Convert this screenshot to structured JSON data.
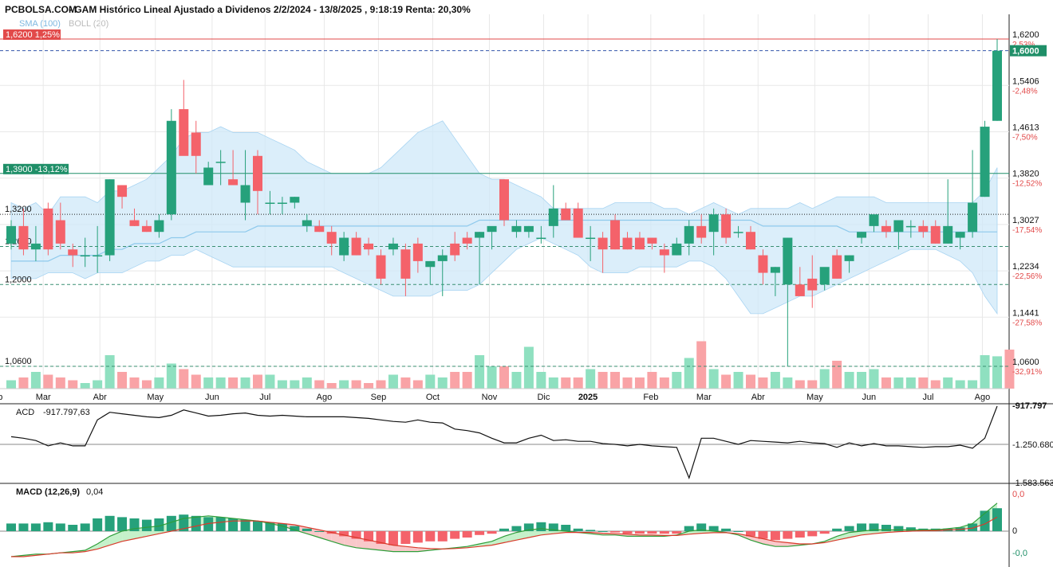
{
  "header": {
    "site": "PCBOLSA.COM",
    "title": "- GAM Histórico Lineal Ajustado a Dividenos 2/2/2024 - 13/8/2025 , 9:18:19 Renta: 20,30%"
  },
  "legend": {
    "sma": "SMA (100)",
    "boll": "BOLL (20)"
  },
  "colors": {
    "up": "#26a17b",
    "down": "#f4626a",
    "band": "#cfe8f8",
    "sma": "#8ec9ec",
    "grid": "#e8e8e8",
    "vol_up": "#8fe0c0",
    "vol_down": "#f9a3a6",
    "alert": "#e24a4a",
    "price_tag": "#1f8f68"
  },
  "price_levels": [
    {
      "label": "1,6200",
      "pct": "2,53%",
      "value": 1.62
    },
    {
      "label": "1,5406",
      "pct": "-2,48%",
      "value": 1.5406
    },
    {
      "label": "1,4613",
      "pct": "-7,50%",
      "value": 1.4613
    },
    {
      "label": "1,3820",
      "pct": "-12,52%",
      "value": 1.382
    },
    {
      "label": "1,3027",
      "pct": "-17,54%",
      "value": 1.3027
    },
    {
      "label": "1,2234",
      "pct": "-22,56%",
      "value": 1.2234
    },
    {
      "label": "1,1441",
      "pct": "-27,58%",
      "value": 1.1441
    },
    {
      "label": "1,0600",
      "pct": "-32,91%",
      "value": 1.06
    }
  ],
  "last_price": {
    "label": "1,6000",
    "value": 1.6
  },
  "alerts": [
    {
      "label": "1,6200",
      "pct": "1,25%",
      "value": 1.62,
      "style": "red"
    },
    {
      "label": "1,3900",
      "pct": "-13,12%",
      "value": 1.39,
      "style": "green"
    }
  ],
  "reference_lines": [
    {
      "label": "1,3200",
      "value": 1.32,
      "style": "black-dots"
    },
    {
      "label": "1,2650",
      "value": 1.265,
      "style": "dash"
    },
    {
      "label": "1,2000",
      "value": 1.2,
      "style": "dash"
    },
    {
      "label": "1,0600",
      "value": 1.06,
      "style": "dash"
    }
  ],
  "months": [
    {
      "label": "Feb",
      "i": -1.3
    },
    {
      "label": "Mar",
      "i": 2.6
    },
    {
      "label": "Abr",
      "i": 7.2
    },
    {
      "label": "May",
      "i": 11.7
    },
    {
      "label": "Jun",
      "i": 16.3
    },
    {
      "label": "Jul",
      "i": 20.6
    },
    {
      "label": "Ago",
      "i": 25.4
    },
    {
      "label": "Sep",
      "i": 29.8
    },
    {
      "label": "Oct",
      "i": 34.2
    },
    {
      "label": "Nov",
      "i": 38.8
    },
    {
      "label": "Dic",
      "i": 43.2
    },
    {
      "label": "2025",
      "i": 46.8,
      "bold": true
    },
    {
      "label": "Feb",
      "i": 51.9
    },
    {
      "label": "Mar",
      "i": 56.2
    },
    {
      "label": "Abr",
      "i": 60.6
    },
    {
      "label": "May",
      "i": 65.2
    },
    {
      "label": "Jun",
      "i": 69.6
    },
    {
      "label": "Jul",
      "i": 74.4
    },
    {
      "label": "Ago",
      "i": 78.8
    }
  ],
  "chart_data": {
    "type": "candlestick",
    "yrange": [
      1.06,
      1.62
    ],
    "candles": [
      [
        1.27,
        1.31,
        1.26,
        1.3
      ],
      [
        1.3,
        1.33,
        1.25,
        1.26
      ],
      [
        1.26,
        1.3,
        1.24,
        1.27
      ],
      [
        1.33,
        1.34,
        1.25,
        1.26
      ],
      [
        1.31,
        1.34,
        1.26,
        1.27
      ],
      [
        1.26,
        1.27,
        1.23,
        1.25
      ],
      [
        1.25,
        1.28,
        1.23,
        1.25
      ],
      [
        1.25,
        1.3,
        1.22,
        1.25
      ],
      [
        1.25,
        1.38,
        1.24,
        1.38
      ],
      [
        1.37,
        1.37,
        1.33,
        1.35
      ],
      [
        1.31,
        1.33,
        1.3,
        1.3
      ],
      [
        1.3,
        1.31,
        1.29,
        1.29
      ],
      [
        1.29,
        1.32,
        1.28,
        1.31
      ],
      [
        1.32,
        1.5,
        1.31,
        1.48
      ],
      [
        1.5,
        1.55,
        1.44,
        1.42
      ],
      [
        1.46,
        1.48,
        1.39,
        1.42
      ],
      [
        1.37,
        1.41,
        1.37,
        1.4
      ],
      [
        1.41,
        1.43,
        1.37,
        1.41
      ],
      [
        1.38,
        1.43,
        1.37,
        1.37
      ],
      [
        1.34,
        1.43,
        1.31,
        1.37
      ],
      [
        1.42,
        1.43,
        1.32,
        1.36
      ],
      [
        1.34,
        1.36,
        1.32,
        1.34
      ],
      [
        1.34,
        1.35,
        1.32,
        1.34
      ],
      [
        1.34,
        1.35,
        1.33,
        1.35
      ],
      [
        1.3,
        1.32,
        1.29,
        1.31
      ],
      [
        1.3,
        1.31,
        1.29,
        1.29
      ],
      [
        1.29,
        1.3,
        1.25,
        1.27
      ],
      [
        1.25,
        1.29,
        1.24,
        1.28
      ],
      [
        1.28,
        1.29,
        1.25,
        1.25
      ],
      [
        1.27,
        1.28,
        1.25,
        1.26
      ],
      [
        1.25,
        1.26,
        1.2,
        1.21
      ],
      [
        1.26,
        1.28,
        1.25,
        1.27
      ],
      [
        1.26,
        1.27,
        1.18,
        1.21
      ],
      [
        1.27,
        1.28,
        1.22,
        1.24
      ],
      [
        1.23,
        1.24,
        1.2,
        1.24
      ],
      [
        1.24,
        1.26,
        1.18,
        1.25
      ],
      [
        1.27,
        1.29,
        1.24,
        1.25
      ],
      [
        1.28,
        1.29,
        1.26,
        1.27
      ],
      [
        1.28,
        1.29,
        1.2,
        1.29
      ],
      [
        1.29,
        1.29,
        1.26,
        1.3
      ],
      [
        1.38,
        1.38,
        1.3,
        1.31
      ],
      [
        1.29,
        1.31,
        1.28,
        1.3
      ],
      [
        1.29,
        1.3,
        1.28,
        1.3
      ],
      [
        1.28,
        1.3,
        1.27,
        1.28
      ],
      [
        1.3,
        1.37,
        1.28,
        1.33
      ],
      [
        1.33,
        1.34,
        1.31,
        1.31
      ],
      [
        1.33,
        1.34,
        1.28,
        1.28
      ],
      [
        1.28,
        1.3,
        1.24,
        1.28
      ],
      [
        1.28,
        1.29,
        1.22,
        1.26
      ],
      [
        1.31,
        1.32,
        1.26,
        1.26
      ],
      [
        1.28,
        1.29,
        1.26,
        1.26
      ],
      [
        1.28,
        1.29,
        1.26,
        1.26
      ],
      [
        1.28,
        1.28,
        1.26,
        1.27
      ],
      [
        1.26,
        1.27,
        1.22,
        1.25
      ],
      [
        1.25,
        1.28,
        1.25,
        1.27
      ],
      [
        1.27,
        1.31,
        1.25,
        1.3
      ],
      [
        1.3,
        1.32,
        1.27,
        1.28
      ],
      [
        1.29,
        1.33,
        1.25,
        1.32
      ],
      [
        1.32,
        1.33,
        1.27,
        1.28
      ],
      [
        1.29,
        1.3,
        1.28,
        1.29
      ],
      [
        1.29,
        1.3,
        1.26,
        1.26
      ],
      [
        1.25,
        1.26,
        1.2,
        1.22
      ],
      [
        1.22,
        1.23,
        1.18,
        1.23
      ],
      [
        1.2,
        1.28,
        1.06,
        1.28
      ],
      [
        1.2,
        1.23,
        1.18,
        1.18
      ],
      [
        1.21,
        1.25,
        1.16,
        1.19
      ],
      [
        1.2,
        1.22,
        1.19,
        1.23
      ],
      [
        1.25,
        1.26,
        1.21,
        1.21
      ],
      [
        1.24,
        1.25,
        1.22,
        1.25
      ],
      [
        1.28,
        1.29,
        1.27,
        1.29
      ],
      [
        1.3,
        1.32,
        1.29,
        1.32
      ],
      [
        1.3,
        1.31,
        1.28,
        1.29
      ],
      [
        1.29,
        1.31,
        1.26,
        1.31
      ],
      [
        1.3,
        1.31,
        1.28,
        1.3
      ],
      [
        1.3,
        1.31,
        1.28,
        1.29
      ],
      [
        1.3,
        1.31,
        1.27,
        1.27
      ],
      [
        1.27,
        1.38,
        1.27,
        1.3
      ],
      [
        1.28,
        1.29,
        1.26,
        1.29
      ],
      [
        1.29,
        1.43,
        1.28,
        1.34
      ],
      [
        1.35,
        1.48,
        1.35,
        1.47
      ],
      [
        1.48,
        1.62,
        1.48,
        1.6
      ]
    ],
    "bollinger": {
      "upper": [
        1.34,
        1.33,
        1.34,
        1.32,
        1.35,
        1.35,
        1.35,
        1.34,
        1.36,
        1.36,
        1.37,
        1.38,
        1.4,
        1.42,
        1.45,
        1.46,
        1.46,
        1.47,
        1.46,
        1.46,
        1.46,
        1.45,
        1.44,
        1.43,
        1.41,
        1.4,
        1.39,
        1.39,
        1.39,
        1.39,
        1.4,
        1.42,
        1.44,
        1.46,
        1.47,
        1.48,
        1.45,
        1.42,
        1.39,
        1.38,
        1.38,
        1.37,
        1.36,
        1.35,
        1.33,
        1.33,
        1.33,
        1.33,
        1.33,
        1.34,
        1.34,
        1.34,
        1.34,
        1.33,
        1.33,
        1.32,
        1.33,
        1.34,
        1.33,
        1.32,
        1.33,
        1.33,
        1.33,
        1.33,
        1.34,
        1.33,
        1.34,
        1.35,
        1.35,
        1.35,
        1.35,
        1.34,
        1.34,
        1.34,
        1.34,
        1.34,
        1.34,
        1.34,
        1.34,
        1.36,
        1.4
      ],
      "lower": [
        1.21,
        1.21,
        1.21,
        1.22,
        1.22,
        1.22,
        1.21,
        1.22,
        1.22,
        1.22,
        1.23,
        1.24,
        1.24,
        1.25,
        1.25,
        1.26,
        1.25,
        1.24,
        1.23,
        1.23,
        1.23,
        1.23,
        1.23,
        1.23,
        1.23,
        1.23,
        1.23,
        1.22,
        1.21,
        1.2,
        1.19,
        1.18,
        1.18,
        1.18,
        1.18,
        1.19,
        1.19,
        1.19,
        1.2,
        1.22,
        1.24,
        1.26,
        1.27,
        1.28,
        1.27,
        1.26,
        1.25,
        1.23,
        1.22,
        1.22,
        1.22,
        1.23,
        1.23,
        1.23,
        1.23,
        1.24,
        1.24,
        1.23,
        1.21,
        1.18,
        1.15,
        1.15,
        1.16,
        1.17,
        1.18,
        1.18,
        1.19,
        1.2,
        1.21,
        1.22,
        1.23,
        1.24,
        1.25,
        1.26,
        1.26,
        1.26,
        1.25,
        1.24,
        1.22,
        1.18,
        1.15
      ]
    },
    "sma": [
      1.24,
      1.24,
      1.24,
      1.24,
      1.25,
      1.25,
      1.25,
      1.25,
      1.26,
      1.26,
      1.27,
      1.27,
      1.27,
      1.28,
      1.28,
      1.29,
      1.29,
      1.29,
      1.29,
      1.29,
      1.3,
      1.3,
      1.3,
      1.3,
      1.3,
      1.3,
      1.3,
      1.3,
      1.3,
      1.3,
      1.3,
      1.3,
      1.3,
      1.3,
      1.3,
      1.3,
      1.3,
      1.3,
      1.31,
      1.31,
      1.31,
      1.31,
      1.31,
      1.31,
      1.31,
      1.31,
      1.31,
      1.31,
      1.31,
      1.31,
      1.31,
      1.31,
      1.31,
      1.31,
      1.31,
      1.31,
      1.31,
      1.31,
      1.31,
      1.31,
      1.31,
      1.3,
      1.3,
      1.3,
      1.3,
      1.3,
      1.3,
      1.3,
      1.29,
      1.29,
      1.29,
      1.29,
      1.29,
      1.29,
      1.29,
      1.29,
      1.29,
      1.29,
      1.29,
      1.29,
      1.29
    ],
    "volume": [
      0.15,
      0.2,
      0.3,
      0.25,
      0.2,
      0.15,
      0.1,
      0.15,
      0.6,
      0.3,
      0.2,
      0.15,
      0.2,
      0.45,
      0.35,
      0.25,
      0.2,
      0.2,
      0.2,
      0.2,
      0.25,
      0.25,
      0.15,
      0.15,
      0.2,
      0.15,
      0.1,
      0.15,
      0.15,
      0.1,
      0.15,
      0.25,
      0.2,
      0.15,
      0.25,
      0.2,
      0.3,
      0.3,
      0.6,
      0.4,
      0.4,
      0.3,
      0.75,
      0.3,
      0.2,
      0.2,
      0.2,
      0.35,
      0.3,
      0.3,
      0.2,
      0.2,
      0.3,
      0.2,
      0.3,
      0.55,
      0.85,
      0.35,
      0.25,
      0.3,
      0.25,
      0.2,
      0.3,
      0.2,
      0.15,
      0.15,
      0.35,
      0.5,
      0.3,
      0.3,
      0.35,
      0.2,
      0.2,
      0.2,
      0.2,
      0.15,
      0.2,
      0.15,
      0.15,
      0.6,
      0.58,
      0.7
    ]
  },
  "acd": {
    "label": "ACD",
    "value": "-917.797,63",
    "right_label": "-1.250.680",
    "top_label": "-917.797",
    "bottom_label": "-1.583.563",
    "series": [
      0.6,
      0.58,
      0.55,
      0.48,
      0.52,
      0.48,
      0.48,
      0.82,
      0.92,
      0.9,
      0.88,
      0.86,
      0.85,
      0.88,
      0.95,
      0.91,
      0.87,
      0.88,
      0.9,
      0.91,
      0.88,
      0.87,
      0.88,
      0.87,
      0.86,
      0.86,
      0.86,
      0.86,
      0.85,
      0.84,
      0.82,
      0.8,
      0.79,
      0.82,
      0.79,
      0.78,
      0.7,
      0.68,
      0.65,
      0.58,
      0.52,
      0.52,
      0.58,
      0.62,
      0.55,
      0.56,
      0.54,
      0.54,
      0.51,
      0.5,
      0.48,
      0.5,
      0.48,
      0.47,
      0.46,
      0.06,
      0.58,
      0.58,
      0.54,
      0.5,
      0.55,
      0.54,
      0.53,
      0.52,
      0.54,
      0.52,
      0.51,
      0.46,
      0.52,
      0.48,
      0.51,
      0.48,
      0.48,
      0.47,
      0.46,
      0.47,
      0.47,
      0.49,
      0.45,
      0.58,
      1.0
    ]
  },
  "macd": {
    "label": "MACD (12,26,9)",
    "value": "0,04",
    "top_label": "0,0",
    "mid_label": "0",
    "bottom_label": "-0,0",
    "hist": [
      0.3,
      0.3,
      0.3,
      0.35,
      0.3,
      0.25,
      0.3,
      0.5,
      0.6,
      0.55,
      0.5,
      0.45,
      0.5,
      0.6,
      0.65,
      0.6,
      0.55,
      0.55,
      0.5,
      0.45,
      0.4,
      0.35,
      0.3,
      0.2,
      0.1,
      0.0,
      -0.1,
      -0.2,
      -0.3,
      -0.4,
      -0.5,
      -0.55,
      -0.5,
      -0.45,
      -0.4,
      -0.4,
      -0.3,
      -0.25,
      -0.15,
      -0.1,
      0.1,
      0.2,
      0.3,
      0.35,
      0.3,
      0.25,
      0.1,
      0.05,
      0.0,
      -0.05,
      -0.1,
      -0.1,
      -0.1,
      -0.1,
      -0.1,
      0.2,
      0.3,
      0.2,
      0.1,
      0.0,
      -0.2,
      -0.3,
      -0.35,
      -0.3,
      -0.25,
      -0.2,
      -0.1,
      0.1,
      0.2,
      0.3,
      0.3,
      0.25,
      0.2,
      0.15,
      0.1,
      0.1,
      0.1,
      0.15,
      0.3,
      0.8,
      0.9
    ],
    "line": [
      -1.0,
      -0.95,
      -0.9,
      -0.9,
      -0.85,
      -0.8,
      -0.75,
      -0.5,
      -0.2,
      0.0,
      0.1,
      0.15,
      0.2,
      0.35,
      0.5,
      0.55,
      0.6,
      0.55,
      0.5,
      0.45,
      0.4,
      0.3,
      0.2,
      0.05,
      -0.1,
      -0.25,
      -0.4,
      -0.55,
      -0.65,
      -0.7,
      -0.75,
      -0.8,
      -0.8,
      -0.8,
      -0.75,
      -0.7,
      -0.65,
      -0.6,
      -0.5,
      -0.4,
      -0.2,
      -0.05,
      0.05,
      0.1,
      0.05,
      0.0,
      -0.05,
      -0.1,
      -0.15,
      -0.15,
      -0.2,
      -0.2,
      -0.2,
      -0.2,
      -0.15,
      0.0,
      0.05,
      0.0,
      -0.05,
      -0.15,
      -0.35,
      -0.5,
      -0.6,
      -0.6,
      -0.55,
      -0.5,
      -0.4,
      -0.2,
      -0.05,
      0.0,
      0.05,
      0.05,
      0.05,
      0.05,
      0.05,
      0.05,
      0.1,
      0.15,
      0.3,
      0.7,
      1.1
    ],
    "signal": [
      -1.0,
      -1.0,
      -0.95,
      -0.9,
      -0.85,
      -0.85,
      -0.8,
      -0.7,
      -0.55,
      -0.4,
      -0.3,
      -0.2,
      -0.1,
      0.0,
      0.1,
      0.2,
      0.3,
      0.35,
      0.4,
      0.4,
      0.4,
      0.35,
      0.3,
      0.25,
      0.15,
      0.05,
      -0.05,
      -0.15,
      -0.25,
      -0.35,
      -0.45,
      -0.55,
      -0.6,
      -0.65,
      -0.68,
      -0.7,
      -0.68,
      -0.65,
      -0.6,
      -0.55,
      -0.45,
      -0.35,
      -0.25,
      -0.15,
      -0.1,
      -0.05,
      -0.05,
      -0.05,
      -0.08,
      -0.1,
      -0.12,
      -0.15,
      -0.15,
      -0.17,
      -0.17,
      -0.12,
      -0.08,
      -0.06,
      -0.06,
      -0.1,
      -0.2,
      -0.3,
      -0.4,
      -0.45,
      -0.5,
      -0.5,
      -0.45,
      -0.35,
      -0.25,
      -0.15,
      -0.1,
      -0.05,
      -0.02,
      0.0,
      0.02,
      0.02,
      0.05,
      0.07,
      0.12,
      0.28,
      0.55
    ]
  }
}
